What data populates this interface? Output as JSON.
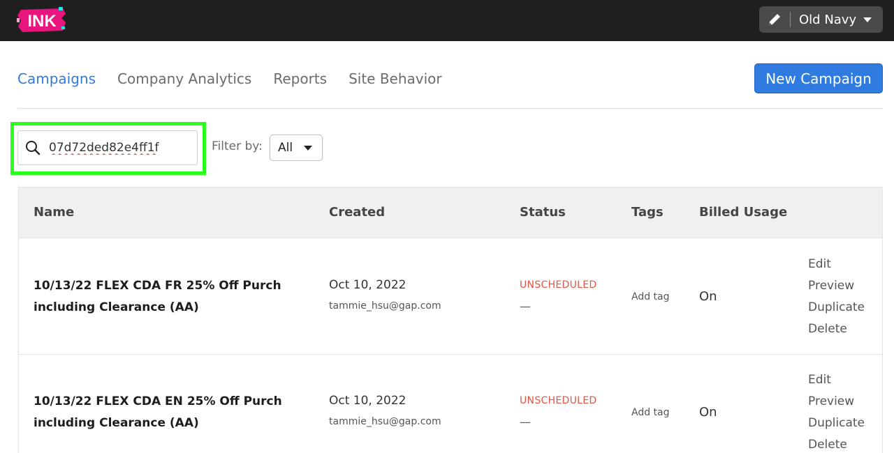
{
  "header": {
    "logo_text": "INK",
    "account_name": "Old Navy",
    "icons": [
      "pencil-icon",
      "chevron-down-icon"
    ]
  },
  "nav": {
    "tabs": [
      {
        "label": "Campaigns",
        "active": true
      },
      {
        "label": "Company Analytics",
        "active": false
      },
      {
        "label": "Reports",
        "active": false
      },
      {
        "label": "Site Behavior",
        "active": false
      }
    ],
    "new_campaign_label": "New Campaign"
  },
  "search": {
    "value": "07d72ded82e4ff1f",
    "icon": "search-icon"
  },
  "filter": {
    "label": "Filter by:",
    "selected": "All"
  },
  "table": {
    "headers": [
      "Name",
      "Created",
      "Status",
      "Tags",
      "Billed Usage"
    ],
    "rows": [
      {
        "name_line1": "10/13/22 FLEX CDA FR 25% Off Purch",
        "name_line2": "including Clearance (AA)",
        "created_date": "Oct 10, 2022",
        "created_by": "tammie_hsu@gap.com",
        "status": "UNSCHEDULED",
        "status_sub": "—",
        "tag_label": "Add tag",
        "billed": "On",
        "actions": [
          "Edit",
          "Preview",
          "Duplicate",
          "Delete"
        ]
      },
      {
        "name_line1": "10/13/22 FLEX CDA EN 25% Off Purch",
        "name_line2": "including Clearance (AA)",
        "created_date": "Oct 10, 2022",
        "created_by": "tammie_hsu@gap.com",
        "status": "UNSCHEDULED",
        "status_sub": "—",
        "tag_label": "Add tag",
        "billed": "On",
        "actions": [
          "Edit",
          "Preview",
          "Duplicate",
          "Delete"
        ]
      }
    ]
  },
  "colors": {
    "topbar": "#1f1f1f",
    "accent": "#2f7be0",
    "status_unscheduled": "#e05545",
    "highlight": "#2bff1c",
    "logo_pink": "#e8157f"
  }
}
